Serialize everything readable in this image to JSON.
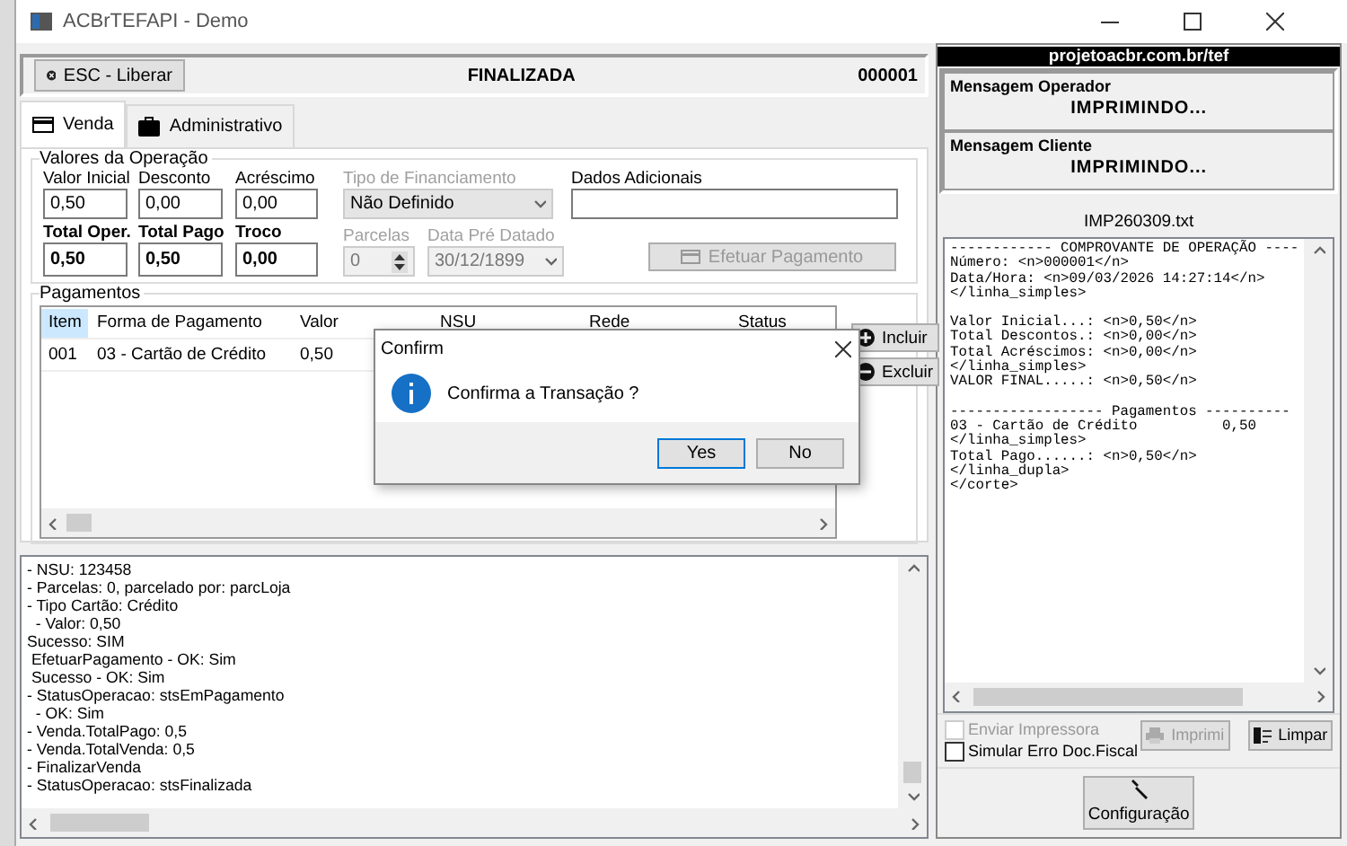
{
  "window": {
    "title": "ACBrTEFAPI - Demo"
  },
  "header": {
    "esc_button": "ESC - Liberar",
    "status": "FINALIZADA",
    "number": "000001"
  },
  "tabs": [
    {
      "label": "Venda",
      "selected": true
    },
    {
      "label": "Administrativo",
      "selected": false
    }
  ],
  "valores": {
    "title": "Valores da Operação",
    "row_1": [
      {
        "label": "Valor Inicial",
        "value": "0,50",
        "kind": "edit"
      },
      {
        "label": "Desconto",
        "value": "0,00",
        "kind": "edit"
      },
      {
        "label": "Acréscimo",
        "value": "0,00",
        "kind": "edit"
      },
      {
        "label": "Tipo de Financiamento",
        "value": "Não Definido",
        "kind": "combo",
        "disabled": true
      },
      {
        "label": "Dados Adicionais",
        "kind": "wide"
      }
    ],
    "row_2": [
      {
        "label": "Total Oper.",
        "value": "0,50",
        "kind": "bold"
      },
      {
        "label": "Total Pago",
        "value": "0,50",
        "kind": "bold"
      },
      {
        "label": "Troco",
        "value": "0,00",
        "kind": "bold"
      },
      {
        "label": "Parcelas",
        "value": "0",
        "kind": "spin",
        "disabled": true
      },
      {
        "label": "Data Pré Datado",
        "value": "30/12/1899",
        "kind": "date",
        "disabled": true
      }
    ],
    "pay_button": {
      "label": "Efetuar Pagamento",
      "disabled": true
    }
  },
  "pagamentos": {
    "title": "Pagamentos",
    "columns": [
      {
        "label": "Item",
        "selected": true
      },
      {
        "label": "Forma de Pagamento",
        "selected": false
      },
      {
        "label": "Valor",
        "selected": false
      },
      {
        "label": "NSU",
        "selected": false
      },
      {
        "label": "Rede",
        "selected": false
      },
      {
        "label": "Status",
        "selected": false
      }
    ],
    "rows": [
      [
        "001",
        "03 - Cartão de Crédito",
        "0,50"
      ]
    ],
    "buttons": [
      {
        "label": "Incluir",
        "kind": "add"
      },
      {
        "label": "Excluir",
        "kind": "remove"
      }
    ]
  },
  "log": [
    "- NSU: 123458",
    "- Parcelas: 0, parcelado por: parcLoja",
    "- Tipo Cartão: Crédito",
    "  - Valor: 0,50",
    "Sucesso: SIM",
    " EfetuarPagamento - OK: Sim",
    " Sucesso - OK: Sim",
    "- StatusOperacao: stsEmPagamento",
    "  - OK: Sim",
    "- Venda.TotalPago: 0,5",
    "- Venda.TotalVenda: 0,5",
    "- FinalizarVenda",
    "- StatusOperacao: stsFinalizada"
  ],
  "tef": {
    "site": "projetoacbr.com.br/tef",
    "messages": [
      {
        "label": "Mensagem Operador",
        "text": "IMPRIMINDO..."
      },
      {
        "label": "Mensagem Cliente",
        "text": "IMPRIMINDO..."
      }
    ],
    "file": "IMP260309.txt",
    "receipt": [
      [
        "------------ COMPROVANTE DE OPERAÇÃO ----",
        "Número: <n>000001</n>",
        "Data/Hora: <n>09/03/2026 14:27:14</n>",
        "</linha_simples>"
      ],
      [
        "Valor Inicial...: <n>0,50</n>",
        "Total Descontos.: <n>0,00</n>",
        "Total Acréscimos: <n>0,00</n>",
        "</linha_simples>",
        "VALOR FINAL.....: <n>0,50</n>"
      ],
      [
        "------------------ Pagamentos ----------",
        "03 - Cartão de Crédito          0,50",
        "</linha_simples>",
        "Total Pago......: <n>0,50</n>",
        "</linha_dupla>",
        "</corte>"
      ]
    ],
    "options": [
      {
        "label": "Enviar Impressora",
        "checked": false,
        "disabled": true
      },
      {
        "label": "Simular Erro Doc.Fiscal",
        "checked": false,
        "disabled": false
      }
    ],
    "print_button": {
      "label": "Imprimi",
      "disabled": true
    },
    "clear_button": {
      "label": "Limpar"
    },
    "config_button": {
      "label": "Configuração"
    }
  },
  "dialog": {
    "title": "Confirm",
    "message": "Confirma a Transação ?",
    "buttons": [
      {
        "label": "Yes",
        "selected": true
      },
      {
        "label": "No",
        "selected": false
      }
    ]
  }
}
